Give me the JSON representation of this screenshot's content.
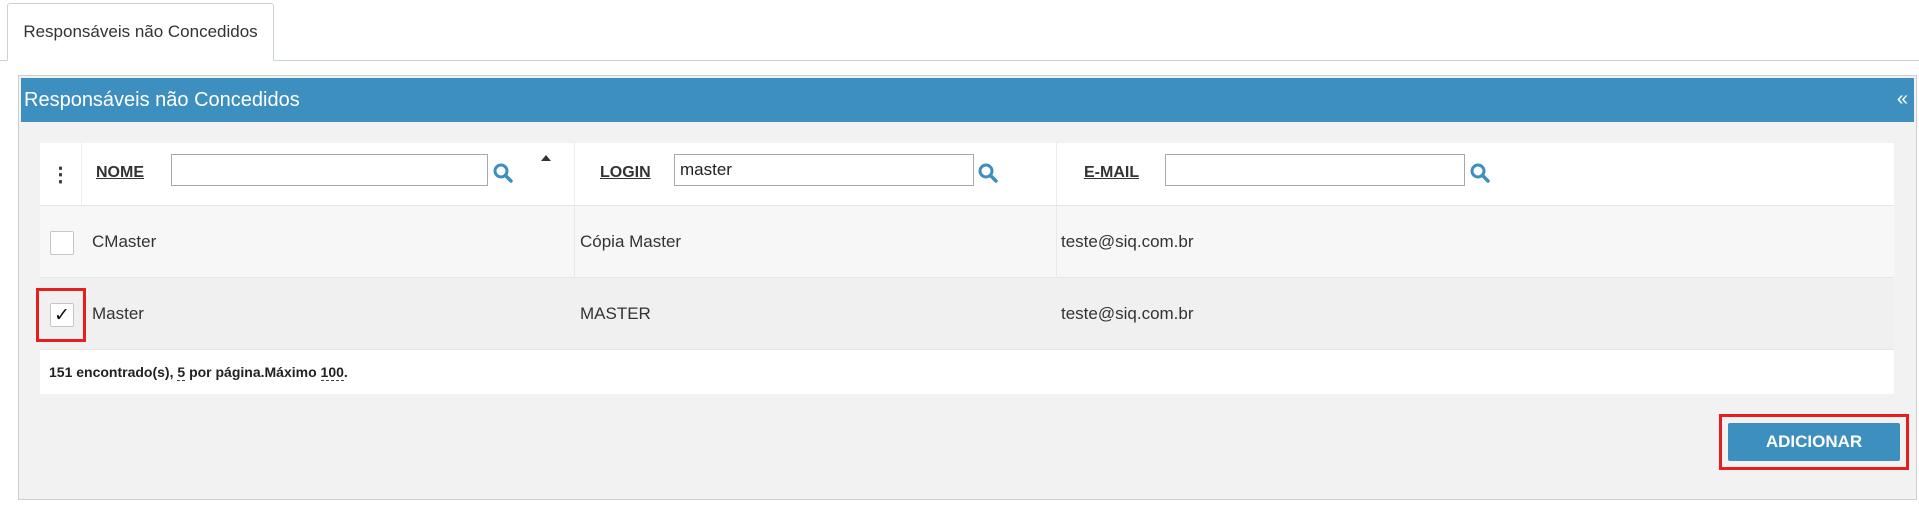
{
  "tab": {
    "label": "Responsáveis não Concedidos"
  },
  "panel": {
    "title": "Responsáveis não Concedidos",
    "collapse_icon": "«"
  },
  "grid": {
    "columns": [
      {
        "name": "NOME",
        "filter_value": ""
      },
      {
        "name": "LOGIN",
        "filter_value": "master"
      },
      {
        "name": "E-MAIL",
        "filter_value": ""
      }
    ],
    "rows": [
      {
        "checked": false,
        "nome": "CMaster",
        "login": "Cópia Master",
        "email": "teste@siq.com.br"
      },
      {
        "checked": true,
        "nome": "Master",
        "login": "MASTER",
        "email": "teste@siq.com.br"
      }
    ],
    "footer": {
      "found": "151 encontrado(s),",
      "per_page": "5",
      "per_page_suffix": "por página.Máximo",
      "max": "100",
      "end": "."
    }
  },
  "actions": {
    "add_label": "ADICIONAR"
  },
  "colors": {
    "accent": "#3d8fbf",
    "highlight": "#e61e1e"
  }
}
